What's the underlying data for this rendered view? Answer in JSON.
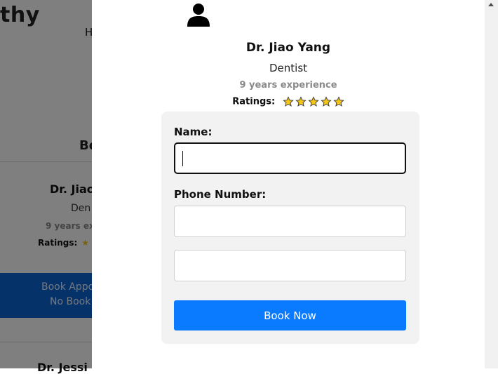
{
  "background": {
    "logo_fragment": "thy",
    "nav_fragment": "H",
    "section_heading_fragment": "Bo",
    "card": {
      "name_fragment": "Dr. Jiao",
      "specialty_fragment": "Den",
      "experience_fragment": "9 years ex",
      "ratings_label": "Ratings:",
      "book_line1_fragment": "Book Appo",
      "book_line2_fragment": "No Book"
    },
    "next_card_name_fragment": "Dr. Jessi"
  },
  "modal": {
    "avatar_icon": "user-icon",
    "doctor_name": "Dr. Jiao Yang",
    "specialty": "Dentist",
    "experience": "9 years experience",
    "ratings_label": "Ratings:",
    "rating_stars": 5,
    "star_color": "#f5c518",
    "form": {
      "name_label": "Name:",
      "name_value": "",
      "phone_label": "Phone Number:",
      "phone_value": "",
      "third_field_value": "",
      "submit_label": "Book Now"
    }
  },
  "colors": {
    "primary_button": "#0a7bff",
    "background_book_button": "#0a64d2",
    "overlay": "rgba(0,0,0,0.5)"
  }
}
